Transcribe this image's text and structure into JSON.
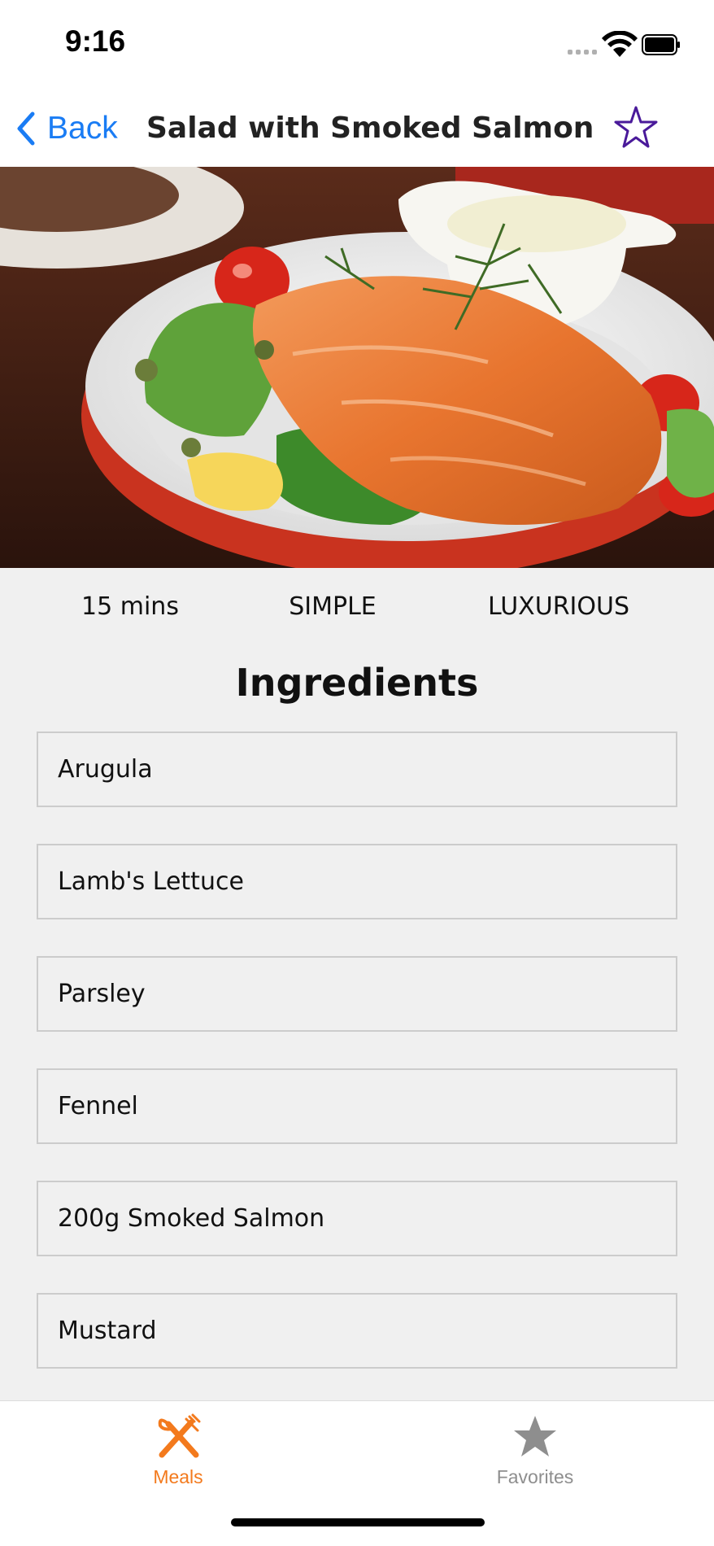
{
  "status_bar": {
    "time": "9:16"
  },
  "nav": {
    "back_label": "Back",
    "title": "Salad with Smoked Salmon",
    "favorite_icon": "star-outline-icon",
    "accent_color": "#1a7cf4",
    "favorite_color": "#4a1a9a"
  },
  "meal": {
    "image_alt": "Salad with Smoked Salmon",
    "duration": "15 mins",
    "complexity": "SIMPLE",
    "affordability": "LUXURIOUS"
  },
  "ingredients_section": {
    "title": "Ingredients",
    "items": [
      "Arugula",
      "Lamb's Lettuce",
      "Parsley",
      "Fennel",
      "200g Smoked Salmon",
      "Mustard"
    ]
  },
  "tab_bar": {
    "tabs": [
      {
        "label": "Meals",
        "icon": "fork-knife-icon",
        "active": true,
        "color": "#f37a1d"
      },
      {
        "label": "Favorites",
        "icon": "star-icon",
        "active": false,
        "color": "#8e8e8e"
      }
    ]
  }
}
